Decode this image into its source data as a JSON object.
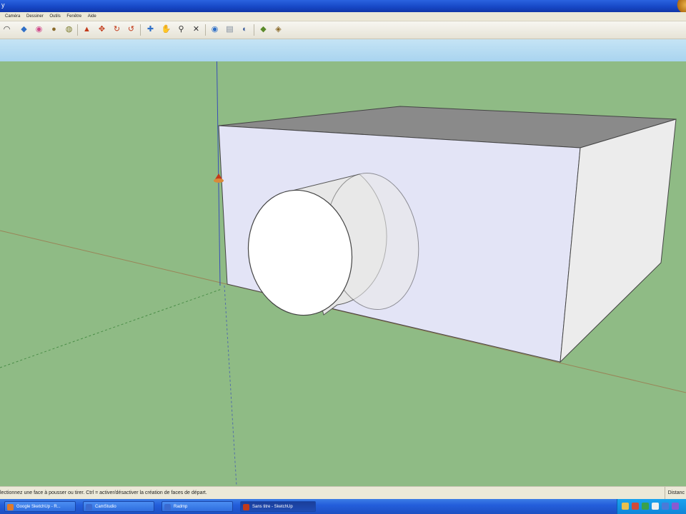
{
  "titlebar": {
    "indicator": "y"
  },
  "menu": {
    "items": [
      "Caméra",
      "Dessiner",
      "Outils",
      "Fenêtre",
      "Aide"
    ]
  },
  "toolbar": {
    "tools": [
      {
        "name": "arc-tool-icon",
        "glyph": "◠",
        "color": "#333333"
      },
      {
        "name": "eraser-tool-icon",
        "glyph": "◆",
        "color": "#2f6fc7"
      },
      {
        "name": "paint-bucket-icon",
        "glyph": "◉",
        "color": "#d04a8a"
      },
      {
        "name": "tape-measure-icon",
        "glyph": "●",
        "color": "#8a6a2a"
      },
      {
        "name": "protractor-icon",
        "glyph": "◍",
        "color": "#7a7a2a"
      },
      {
        "name": "push-pull-icon",
        "glyph": "▲",
        "color": "#c23a1a"
      },
      {
        "name": "move-icon",
        "glyph": "✥",
        "color": "#c23a1a"
      },
      {
        "name": "rotate-icon",
        "glyph": "↻",
        "color": "#c23a1a"
      },
      {
        "name": "follow-me-icon",
        "glyph": "↺",
        "color": "#c23a1a"
      },
      {
        "name": "orbit-icon",
        "glyph": "✚",
        "color": "#2f6fc7"
      },
      {
        "name": "pan-icon",
        "glyph": "✋",
        "color": "#555555"
      },
      {
        "name": "zoom-icon",
        "glyph": "⚲",
        "color": "#333333"
      },
      {
        "name": "zoom-extents-icon",
        "glyph": "✕",
        "color": "#333333"
      },
      {
        "name": "previous-view-icon",
        "glyph": "◉",
        "color": "#2f6fc7"
      },
      {
        "name": "layers-icon",
        "glyph": "▤",
        "color": "#7d8a9a"
      },
      {
        "name": "shadows-icon",
        "glyph": "◐",
        "color": "#3a5a9a"
      },
      {
        "name": "components-icon",
        "glyph": "◆",
        "color": "#5a8a2a"
      },
      {
        "name": "materials-icon",
        "glyph": "◈",
        "color": "#8a6a2a"
      }
    ]
  },
  "status": {
    "message": "lectionnez une face à pousser ou tirer.  Ctrl = activer/désactiver la création de faces de départ.",
    "distance_label": "Distanc"
  },
  "taskbar": {
    "tasks": [
      {
        "label": "Google SketchUp - R...",
        "active": false,
        "icon_color": "#e07a2a"
      },
      {
        "label": "CamStudio",
        "active": false,
        "icon_color": "#3a6ad0"
      },
      {
        "label": "Radmp",
        "active": false,
        "icon_color": "#3a6ad0"
      },
      {
        "label": "Sans titre - SketchUp",
        "active": true,
        "icon_color": "#c23a1a"
      }
    ]
  },
  "colors": {
    "ground": "#8fbb85",
    "box_front": "#e3e4f6",
    "box_top": "#8a8a8a",
    "box_side": "#ececec",
    "cylinder_face": "#ffffff",
    "axis_red": "#a0603a",
    "axis_green": "#2d7a2d",
    "axis_blue": "#2a3ac0"
  }
}
